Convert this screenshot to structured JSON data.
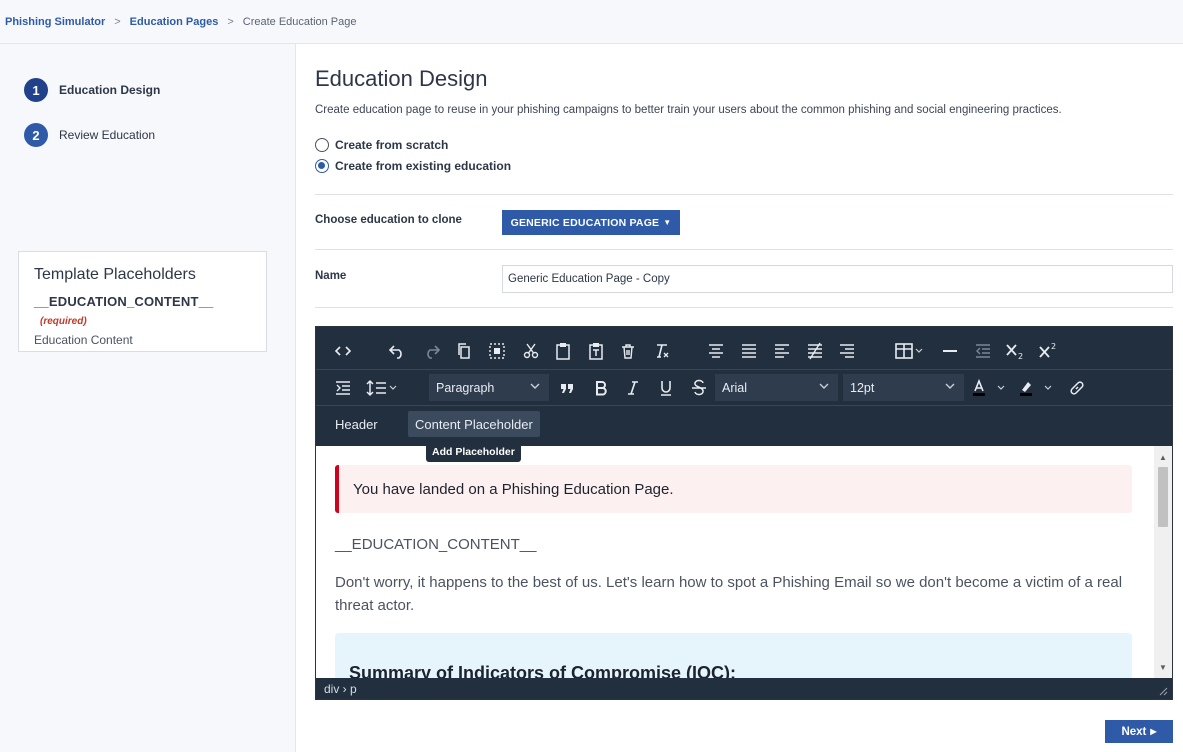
{
  "breadcrumb": {
    "items": [
      "Phishing Simulator",
      "Education Pages",
      "Create Education Page"
    ],
    "separator": ">"
  },
  "steps": [
    {
      "number": "1",
      "label": "Education Design",
      "active": true
    },
    {
      "number": "2",
      "label": "Review Education",
      "active": false
    }
  ],
  "placeholders": {
    "title": "Template Placeholders",
    "code": "__EDUCATION_CONTENT__",
    "required": "(required)",
    "description": "Education Content"
  },
  "main": {
    "title": "Education Design",
    "description": "Create education page to reuse in your phishing campaigns to better train your users about the common phishing and social engineering practices.",
    "options": [
      {
        "label": "Create from scratch",
        "checked": false
      },
      {
        "label": "Create from existing education",
        "checked": true
      }
    ],
    "clone_label": "Choose education to clone",
    "clone_value": "GENERIC EDUCATION PAGE",
    "name_label": "Name",
    "name_value": "Generic Education Page - Copy"
  },
  "editor": {
    "block_format": "Paragraph",
    "font_family": "Arial",
    "font_size": "12pt",
    "menu_header": "Header",
    "menu_content_placeholder": "Content Placeholder",
    "tooltip": "Add Placeholder",
    "alert_text": "You have landed on a Phishing Education Page.",
    "placeholder_code": "__EDUCATION_CONTENT__",
    "paragraph": "Don't worry, it happens to the best of us. Let's learn how to spot a Phishing Email so we don't become a victim of a real threat actor.",
    "ioc_title": "Summary of Indicators of Compromise (IOC):",
    "status_path": "div › p"
  },
  "footer": {
    "next_label": "Next"
  },
  "colors": {
    "accent": "#2e5aa8",
    "toolbar": "#222f3e",
    "alert_border": "#d0021b",
    "required": "#c0392b"
  }
}
